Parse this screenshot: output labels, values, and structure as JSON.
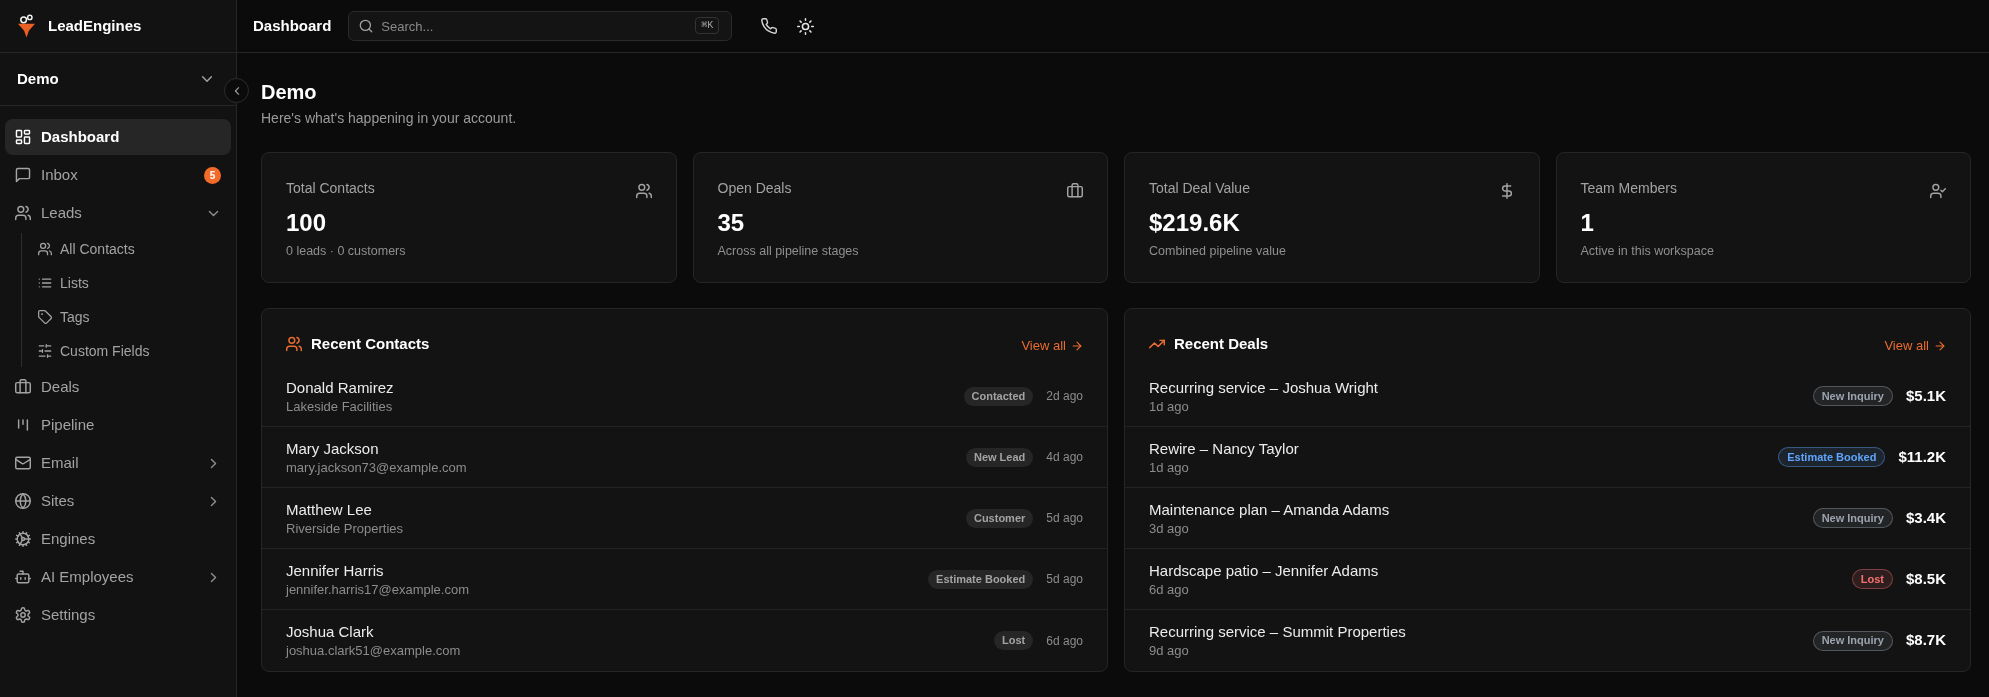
{
  "sidebar": {
    "brand": "LeadEngines",
    "workspace": "Demo",
    "items": [
      {
        "label": "Dashboard",
        "selected": true
      },
      {
        "label": "Inbox",
        "selected": false,
        "badge": "5"
      },
      {
        "label": "Leads",
        "selected": false,
        "expanded": true,
        "children": [
          {
            "label": "All Contacts",
            "selected": false
          },
          {
            "label": "Lists",
            "selected": false
          },
          {
            "label": "Tags",
            "selected": false
          },
          {
            "label": "Custom Fields",
            "selected": false
          }
        ]
      },
      {
        "label": "Deals",
        "selected": false
      },
      {
        "label": "Pipeline",
        "selected": false
      },
      {
        "label": "Email",
        "selected": false,
        "expanded": false
      },
      {
        "label": "Sites",
        "selected": false,
        "expanded": false
      },
      {
        "label": "Engines",
        "selected": false
      },
      {
        "label": "AI Employees",
        "selected": false,
        "expanded": false
      },
      {
        "label": "Settings",
        "selected": false
      }
    ]
  },
  "topbar": {
    "title": "Dashboard",
    "search": {
      "placeholder": "Search...",
      "shortcut": "⌘K"
    }
  },
  "page": {
    "heading": "Demo",
    "subtitle": "Here's what's happening in your account."
  },
  "stats": [
    {
      "label": "Total Contacts",
      "value": "100",
      "note": "0 leads · 0 customers"
    },
    {
      "label": "Open Deals",
      "value": "35",
      "note": "Across all pipeline stages"
    },
    {
      "label": "Total Deal Value",
      "value": "$219.6K",
      "note": "Combined pipeline value"
    },
    {
      "label": "Team Members",
      "value": "1",
      "note": "Active in this workspace"
    }
  ],
  "recent_contacts": {
    "title": "Recent Contacts",
    "link": "View all",
    "rows": [
      {
        "name": "Donald Ramirez",
        "detail": "Lakeside Facilities",
        "status": "Contacted",
        "time": "2d ago"
      },
      {
        "name": "Mary Jackson",
        "detail": "mary.jackson73@example.com",
        "status": "New Lead",
        "time": "4d ago"
      },
      {
        "name": "Matthew Lee",
        "detail": "Riverside Properties",
        "status": "Customer",
        "time": "5d ago"
      },
      {
        "name": "Jennifer Harris",
        "detail": "jennifer.harris17@example.com",
        "status": "Estimate Booked",
        "time": "5d ago"
      },
      {
        "name": "Joshua Clark",
        "detail": "joshua.clark51@example.com",
        "status": "Lost",
        "time": "6d ago"
      }
    ]
  },
  "recent_deals": {
    "title": "Recent Deals",
    "link": "View all",
    "rows": [
      {
        "title": "Recurring service – Joshua Wright",
        "time": "1d ago",
        "stage": "New Inquiry",
        "color": "#9ca3af",
        "amount": "$5.1K"
      },
      {
        "title": "Rewire – Nancy Taylor",
        "time": "1d ago",
        "stage": "Estimate Booked",
        "color": "#60a5fa",
        "amount": "$11.2K"
      },
      {
        "title": "Maintenance plan – Amanda Adams",
        "time": "3d ago",
        "stage": "New Inquiry",
        "color": "#9ca3af",
        "amount": "$3.4K"
      },
      {
        "title": "Hardscape patio – Jennifer Adams",
        "time": "6d ago",
        "stage": "Lost",
        "color": "#f87171",
        "amount": "$8.5K"
      },
      {
        "title": "Recurring service – Summit Properties",
        "time": "9d ago",
        "stage": "New Inquiry",
        "color": "#9ca3af",
        "amount": "$8.7K"
      }
    ]
  }
}
